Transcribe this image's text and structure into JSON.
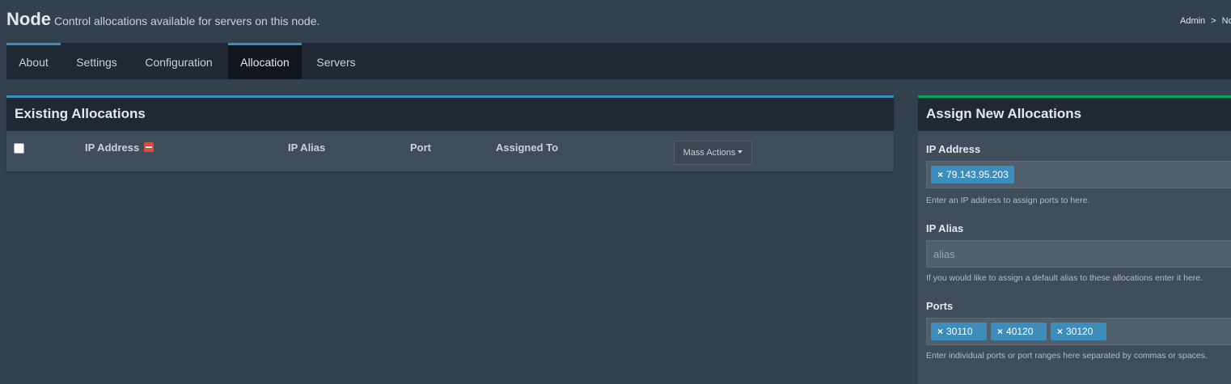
{
  "header": {
    "title": "Node",
    "subtitle": "Control allocations available for servers on this node.",
    "breadcrumb": [
      "Admin",
      ">",
      "No"
    ]
  },
  "tabs": [
    {
      "label": "About",
      "active": false
    },
    {
      "label": "Settings",
      "active": false
    },
    {
      "label": "Configuration",
      "active": false
    },
    {
      "label": "Allocation",
      "active": true
    },
    {
      "label": "Servers",
      "active": false
    }
  ],
  "existing": {
    "title": "Existing Allocations",
    "columns": [
      "IP Address",
      "IP Alias",
      "Port",
      "Assigned To"
    ],
    "mass_actions": "Mass Actions"
  },
  "assign": {
    "title": "Assign New Allocations",
    "ip_label": "IP Address",
    "ip_tags": [
      "79.143.95.203"
    ],
    "ip_help": "Enter an IP address to assign ports to here.",
    "alias_label": "IP Alias",
    "alias_placeholder": "alias",
    "alias_help": "If you would like to assign a default alias to these allocations enter it here.",
    "ports_label": "Ports",
    "port_tags": [
      "30110",
      "40120",
      "30120"
    ],
    "ports_help": "Enter individual ports or port ranges here separated by commas or spaces.",
    "tag_remove": "×"
  },
  "colors": {
    "accent_blue": "#3c8dbc",
    "accent_green": "#00a65a",
    "danger": "#dd4b39",
    "background": "#33404d"
  }
}
